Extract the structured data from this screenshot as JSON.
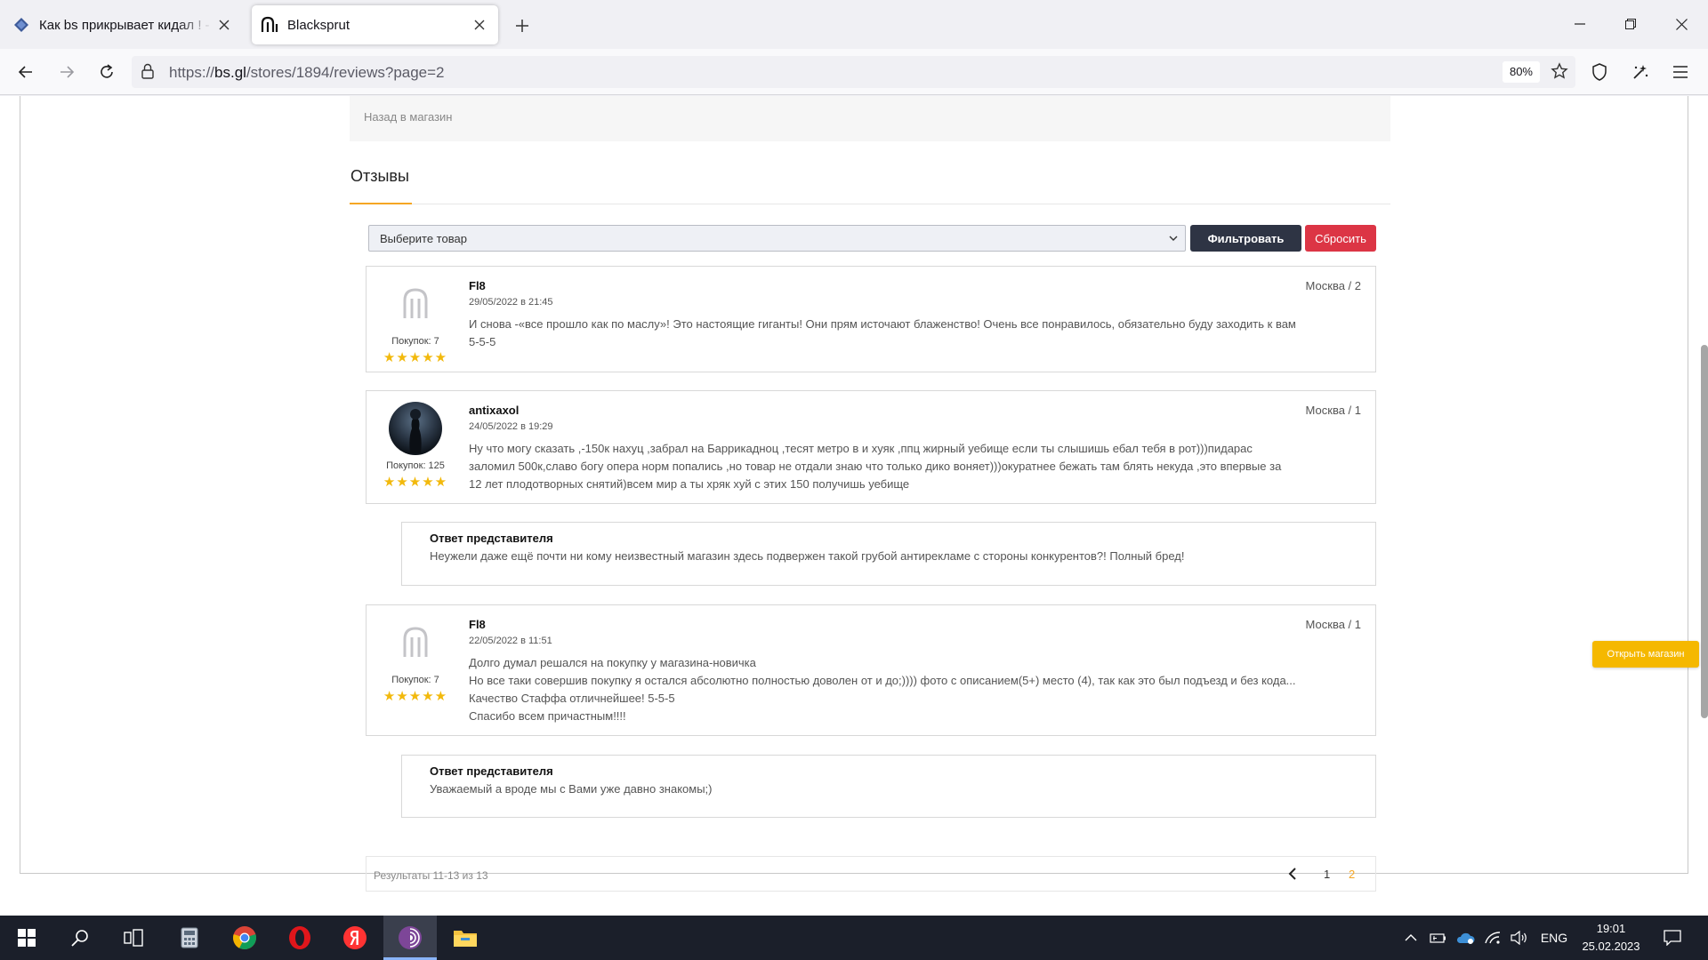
{
  "browser": {
    "tabs": [
      {
        "title": "Как bs прикрывает кидал ! - |R",
        "active": false
      },
      {
        "title": "Blacksprut",
        "active": true
      }
    ],
    "url_prefix": "https://",
    "url_domain": "bs.gl",
    "url_path": "/stores/1894/reviews?page=2",
    "zoom": "80%"
  },
  "page": {
    "back_link": "Назад в магазин",
    "section_title": "Отзывы",
    "select_placeholder": "Выберите товар",
    "filter_label": "Фильтровать",
    "reset_label": "Сбросить",
    "open_shop_label": "Открыть магазин",
    "reviews": [
      {
        "user": "Fl8",
        "date": "29/05/2022 в 21:45",
        "location": "Москва / 2",
        "purchases": "Покупок: 7",
        "stars": "★★★★★",
        "text_lines": [
          "И снова -«все прошло как по маслу»! Это настоящие гиганты! Они прям источают блаженство! Очень все понравилось, обязательно буду заходить к вам",
          "5-5-5"
        ]
      },
      {
        "user": "antixaxol",
        "date": "24/05/2022 в 19:29",
        "location": "Москва / 1",
        "purchases": "Покупок: 125",
        "stars": "★★★★★",
        "text_lines": [
          "Ну что могу сказать ,-150к нахуц ,забрал на Баррикадноц ,тесят метро в и хуяк ,ппц жирный уебище если ты слышишь ебал тебя в рот)))пидарас",
          "заломил 500к,славо богу опера норм попались ,но товар не отдали знаю что только дико воняет)))окуратнее бежать там блять некуда ,это впервые за",
          "12 лет плодотворных снятий)всем мир а ты хряк хуй с этих 150 получишь уебище"
        ],
        "answer_title": "Ответ представителя",
        "answer_text": "Неужели даже ещё почти ни кому неизвестный магазин здесь подвержен такой грубой антирекламе с стороны конкурентов?! Полный бред!"
      },
      {
        "user": "Fl8",
        "date": "22/05/2022 в 11:51",
        "location": "Москва / 1",
        "purchases": "Покупок: 7",
        "stars": "★★★★★",
        "text_lines": [
          "Долго думал решался на покупку у магазина-новичка",
          "Но все таки совершив покупку я остался абсолютно полностью доволен от и до;)))) фото с описанием(5+) место (4), так как это был подъезд и без кода...",
          "Качество Стаффа отличнейшее! 5-5-5",
          "Спасибо всем причастным!!!!"
        ],
        "answer_title": "Ответ представителя",
        "answer_text": "Уважаемый а вроде мы с Вами уже давно знакомы;)"
      }
    ],
    "pagination": {
      "results": "Результаты 11-13 из 13",
      "pages": [
        "1",
        "2"
      ],
      "current": "2"
    }
  },
  "taskbar": {
    "language": "ENG",
    "time": "19:01",
    "date": "25.02.2023"
  }
}
